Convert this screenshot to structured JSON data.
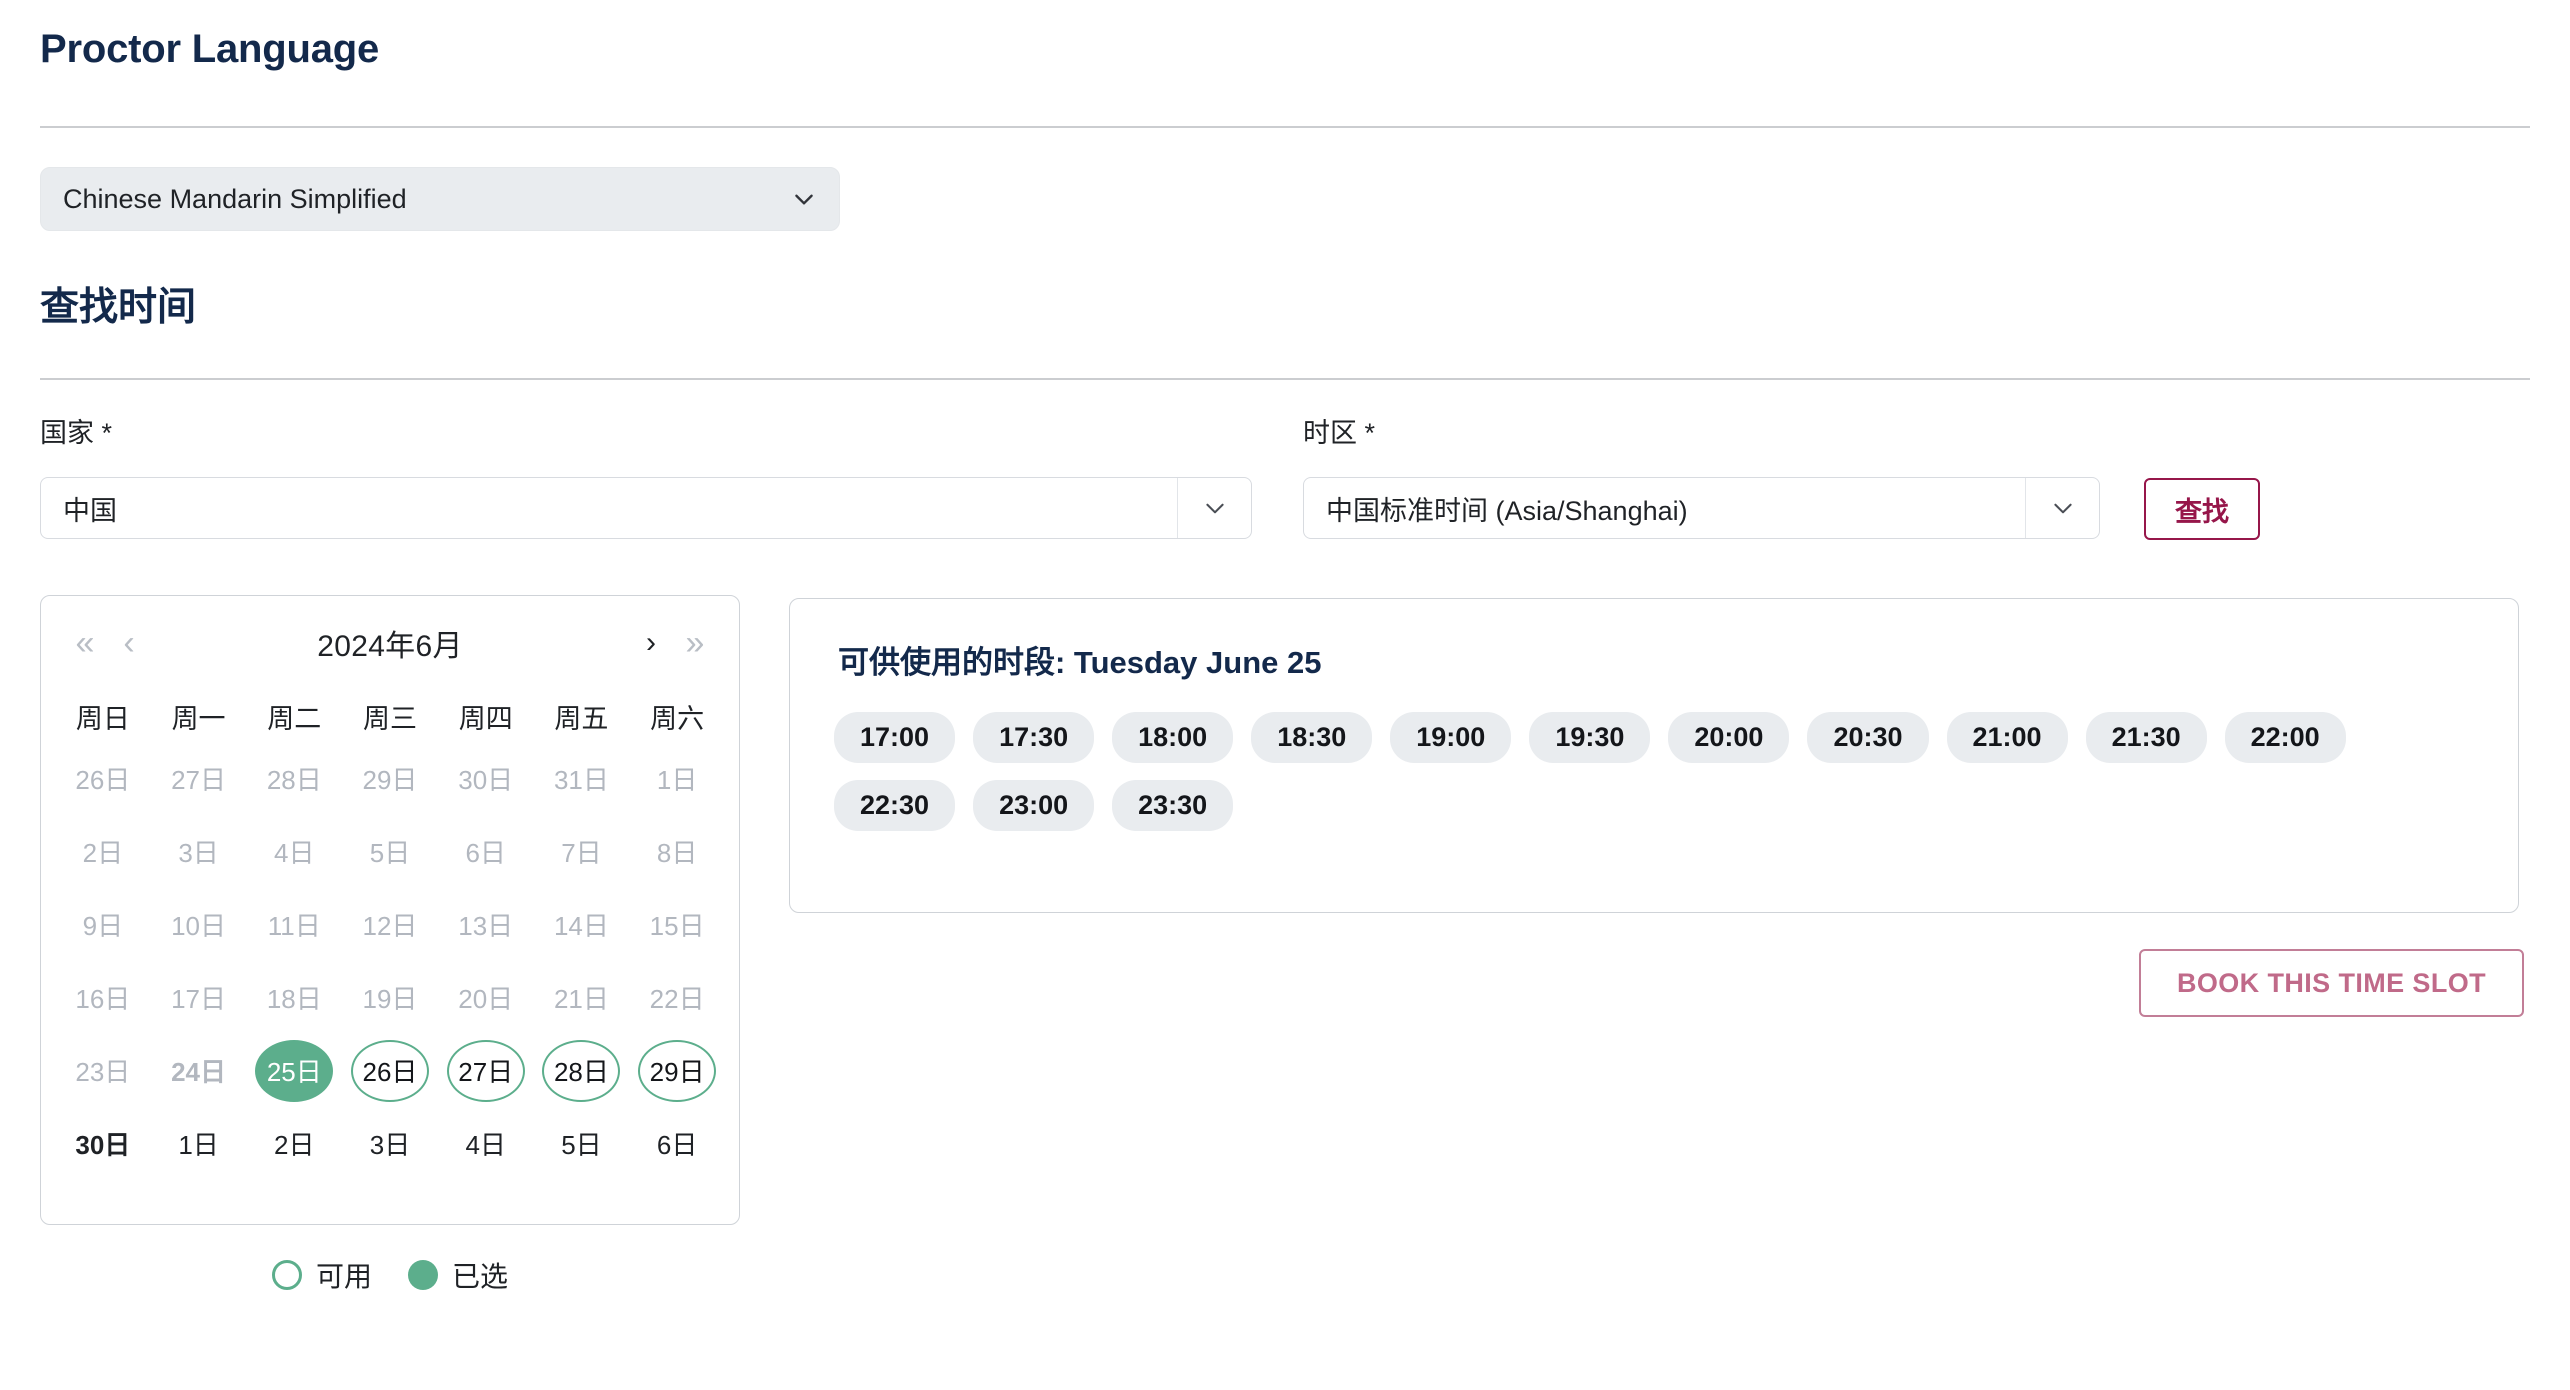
{
  "page": {
    "proctor_heading": "Proctor Language",
    "find_heading": "查找时间"
  },
  "language_select": {
    "name": "proctor-language",
    "value": "Chinese Mandarin Simplified",
    "icon": "chevron-down-icon"
  },
  "form": {
    "country": {
      "label": "国家 *",
      "value": "中国",
      "icon": "chevron-down-icon"
    },
    "timezone": {
      "label": "时区 *",
      "value": "中国标准时间 (Asia/Shanghai)",
      "icon": "chevron-down-icon"
    },
    "search_button": "查找",
    "search_button_color": "#96164A"
  },
  "calendar": {
    "title": "2024年6月",
    "nav": {
      "first": "«",
      "prev": "‹",
      "next": "›",
      "last": "»"
    },
    "weekdays": [
      "周日",
      "周一",
      "周二",
      "周三",
      "周四",
      "周五",
      "周六"
    ],
    "selected_color": "#5CAE8C",
    "available_color": "#5CAE8C",
    "weeks": [
      [
        {
          "label": "26日",
          "state": "muted"
        },
        {
          "label": "27日",
          "state": "muted"
        },
        {
          "label": "28日",
          "state": "muted"
        },
        {
          "label": "29日",
          "state": "muted"
        },
        {
          "label": "30日",
          "state": "muted"
        },
        {
          "label": "31日",
          "state": "muted"
        },
        {
          "label": "1日",
          "state": "muted"
        }
      ],
      [
        {
          "label": "2日",
          "state": "muted"
        },
        {
          "label": "3日",
          "state": "muted"
        },
        {
          "label": "4日",
          "state": "muted"
        },
        {
          "label": "5日",
          "state": "muted"
        },
        {
          "label": "6日",
          "state": "muted"
        },
        {
          "label": "7日",
          "state": "muted"
        },
        {
          "label": "8日",
          "state": "muted"
        }
      ],
      [
        {
          "label": "9日",
          "state": "muted"
        },
        {
          "label": "10日",
          "state": "muted"
        },
        {
          "label": "11日",
          "state": "muted"
        },
        {
          "label": "12日",
          "state": "muted"
        },
        {
          "label": "13日",
          "state": "muted"
        },
        {
          "label": "14日",
          "state": "muted"
        },
        {
          "label": "15日",
          "state": "muted"
        }
      ],
      [
        {
          "label": "16日",
          "state": "muted"
        },
        {
          "label": "17日",
          "state": "muted"
        },
        {
          "label": "18日",
          "state": "muted"
        },
        {
          "label": "19日",
          "state": "muted"
        },
        {
          "label": "20日",
          "state": "muted"
        },
        {
          "label": "21日",
          "state": "muted"
        },
        {
          "label": "22日",
          "state": "muted"
        }
      ],
      [
        {
          "label": "23日",
          "state": "muted"
        },
        {
          "label": "24日",
          "state": "muted-bold"
        },
        {
          "label": "25日",
          "state": "selected"
        },
        {
          "label": "26日",
          "state": "available"
        },
        {
          "label": "27日",
          "state": "available"
        },
        {
          "label": "28日",
          "state": "available"
        },
        {
          "label": "29日",
          "state": "available"
        }
      ],
      [
        {
          "label": "30日",
          "state": "normal-bold"
        },
        {
          "label": "1日",
          "state": "normal"
        },
        {
          "label": "2日",
          "state": "normal"
        },
        {
          "label": "3日",
          "state": "normal"
        },
        {
          "label": "4日",
          "state": "normal"
        },
        {
          "label": "5日",
          "state": "normal"
        },
        {
          "label": "6日",
          "state": "normal"
        }
      ]
    ],
    "legend": [
      {
        "icon": "circle-outline-icon",
        "label": "可用"
      },
      {
        "icon": "circle-filled-icon",
        "label": "已选"
      }
    ]
  },
  "slots": {
    "title": "可供使用的时段: Tuesday June 25",
    "times": [
      "17:00",
      "17:30",
      "18:00",
      "18:30",
      "19:00",
      "19:30",
      "20:00",
      "20:30",
      "21:00",
      "21:30",
      "22:00",
      "22:30",
      "23:00",
      "23:30"
    ]
  },
  "book_button": {
    "label": "BOOK THIS TIME SLOT",
    "color": "#C06A89"
  }
}
